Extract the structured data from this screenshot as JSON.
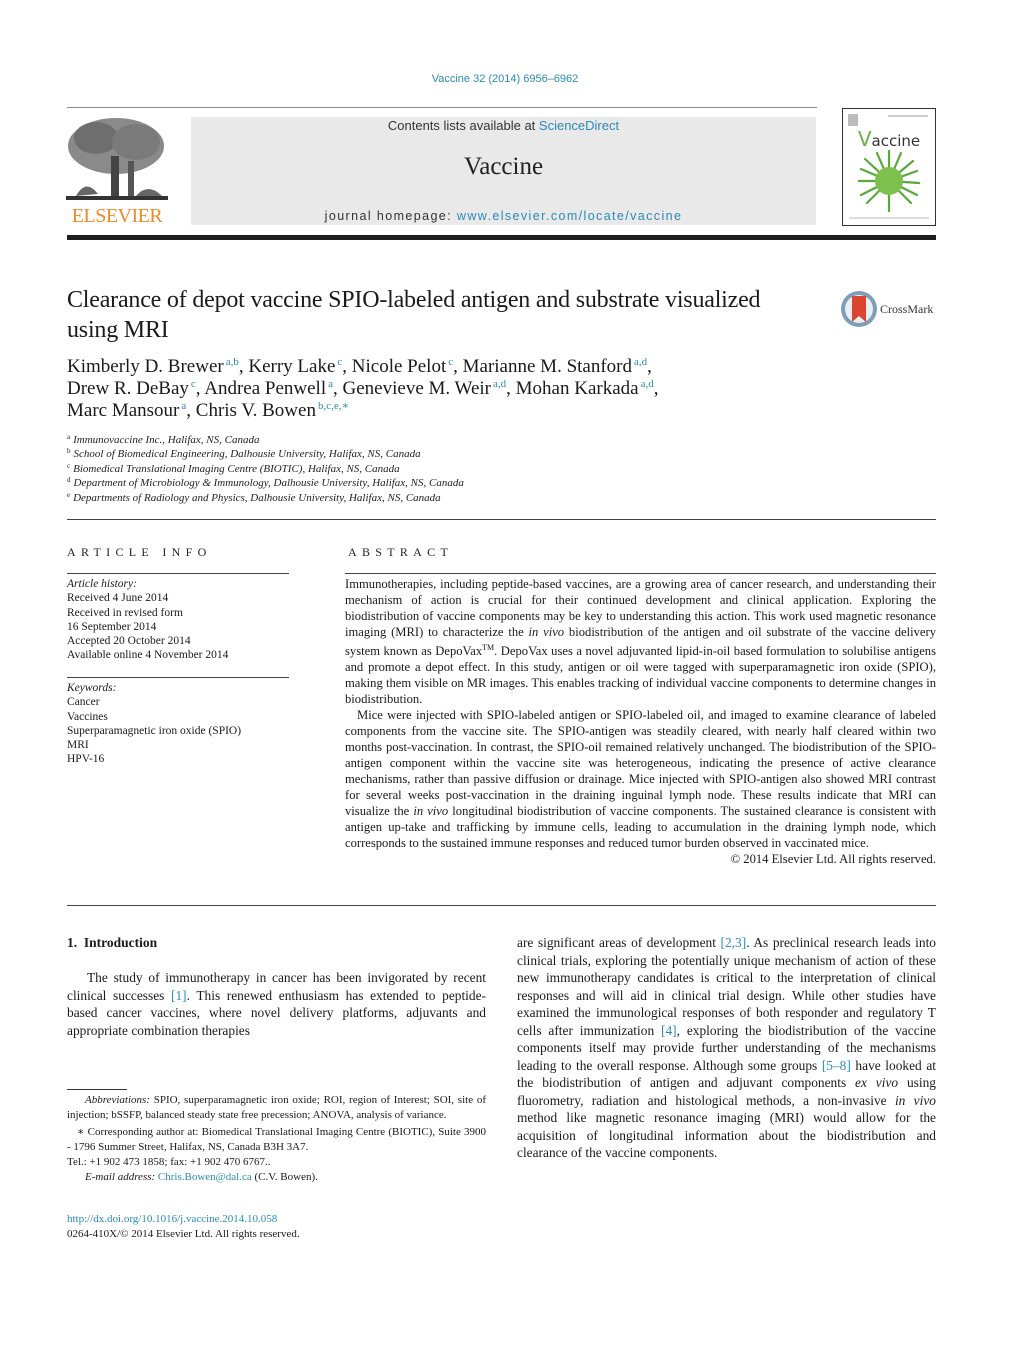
{
  "header": {
    "citation": "Vaccine 32 (2014) 6956–6962",
    "contents_prefix": "Contents lists available at ",
    "contents_link": "ScienceDirect",
    "journal_title": "Vaccine",
    "homepage_prefix": "journal homepage: ",
    "homepage_link": "www.elsevier.com/locate/vaccine",
    "publisher_logo": "ELSEVIER",
    "cover_title_v": "V",
    "cover_title_rest": "accine",
    "colors": {
      "link": "#2a8ab7",
      "elsevier_orange": "#f08a24",
      "banner_bg": "#e9e9e9",
      "cover_green": "#6ab04c"
    }
  },
  "article": {
    "title": "Clearance of depot vaccine SPIO-labeled antigen and substrate visualized using MRI",
    "crossmark_label": "CrossMark",
    "authors": [
      {
        "name": "Kimberly D. Brewer",
        "aff": "a,b"
      },
      {
        "name": "Kerry Lake",
        "aff": "c"
      },
      {
        "name": "Nicole Pelot",
        "aff": "c"
      },
      {
        "name": "Marianne M. Stanford",
        "aff": "a,d"
      },
      {
        "name": "Drew R. DeBay",
        "aff": "c"
      },
      {
        "name": "Andrea Penwell",
        "aff": "a"
      },
      {
        "name": "Genevieve M. Weir",
        "aff": "a,d"
      },
      {
        "name": "Mohan Karkada",
        "aff": "a,d"
      },
      {
        "name": "Marc Mansour",
        "aff": "a"
      },
      {
        "name": "Chris V. Bowen",
        "aff": "b,c,e,∗"
      }
    ],
    "affiliations": [
      {
        "key": "a",
        "text": "Immunovaccine Inc., Halifax, NS, Canada"
      },
      {
        "key": "b",
        "text": "School of Biomedical Engineering, Dalhousie University, Halifax, NS, Canada"
      },
      {
        "key": "c",
        "text": "Biomedical Translational Imaging Centre (BIOTIC), Halifax, NS, Canada"
      },
      {
        "key": "d",
        "text": "Department of Microbiology & Immunology, Dalhousie University, Halifax, NS, Canada"
      },
      {
        "key": "e",
        "text": "Departments of Radiology and Physics, Dalhousie University, Halifax, NS, Canada"
      }
    ]
  },
  "article_info": {
    "heading": "ARTICLE INFO",
    "history_label": "Article history:",
    "history": [
      "Received 4 June 2014",
      "Received in revised form",
      "16 September 2014",
      "Accepted 20 October 2014",
      "Available online 4 November 2014"
    ],
    "keywords_label": "Keywords:",
    "keywords": [
      "Cancer",
      "Vaccines",
      "Superparamagnetic iron oxide (SPIO)",
      "MRI",
      "HPV-16"
    ]
  },
  "abstract": {
    "heading": "ABSTRACT",
    "p1_a": "Immunotherapies, including peptide-based vaccines, are a growing area of cancer research, and understanding their mechanism of action is crucial for their continued development and clinical application. Exploring the biodistribution of vaccine components may be key to understanding this action. This work used magnetic resonance imaging (MRI) to characterize the ",
    "p1_em": "in vivo",
    "p1_b": " biodistribution of the antigen and oil substrate of the vaccine delivery system known as DepoVax",
    "p1_tm": "TM",
    "p1_c": ". DepoVax uses a novel adjuvanted lipid-in-oil based formulation to solubilise antigens and promote a depot effect. In this study, antigen or oil were tagged with superparamagnetic iron oxide (SPIO), making them visible on MR images. This enables tracking of individual vaccine components to determine changes in biodistribution.",
    "p2_a": "Mice were injected with SPIO-labeled antigen or SPIO-labeled oil, and imaged to examine clearance of labeled components from the vaccine site. The SPIO-antigen was steadily cleared, with nearly half cleared within two months post-vaccination. In contrast, the SPIO-oil remained relatively unchanged. The biodistribution of the SPIO-antigen component within the vaccine site was heterogeneous, indicating the presence of active clearance mechanisms, rather than passive diffusion or drainage. Mice injected with SPIO-antigen also showed MRI contrast for several weeks post-vaccination in the draining inguinal lymph node. These results indicate that MRI can visualize the ",
    "p2_em": "in vivo",
    "p2_b": " longitudinal biodistribution of vaccine components. The sustained clearance is consistent with antigen up-take and trafficking by immune cells, leading to accumulation in the draining lymph node, which corresponds to the sustained immune responses and reduced tumor burden observed in vaccinated mice.",
    "copyright": "© 2014 Elsevier Ltd. All rights reserved."
  },
  "introduction": {
    "heading": "1.  Introduction",
    "col1_a": "The study of immunotherapy in cancer has been invigorated by recent clinical successes ",
    "ref1": "[1]",
    "col1_b": ". This renewed enthusiasm has extended to peptide-based cancer vaccines, where novel delivery platforms, adjuvants and appropriate combination therapies",
    "col2_a": "are significant areas of development ",
    "ref2": "[2,3]",
    "col2_b": ". As preclinical research leads into clinical trials, exploring the potentially unique mechanism of action of these new immunotherapy candidates is critical to the interpretation of clinical responses and will aid in clinical trial design. While other studies have examined the immunological responses of both responder and regulatory T cells after immunization ",
    "ref3": "[4]",
    "col2_c": ", exploring the biodistribution of the vaccine components itself may provide further understanding of the mechanisms leading to the overall response. Although some groups ",
    "ref4": "[5–8]",
    "col2_d": " have looked at the biodistribution of antigen and adjuvant components ",
    "col2_em1": "ex vivo",
    "col2_e": " using fluorometry, radiation and histological methods, a non-invasive ",
    "col2_em2": "in vivo",
    "col2_f": " method like magnetic resonance imaging (MRI) would allow for the acquisition of longitudinal information about the biodistribution and clearance of the vaccine components."
  },
  "footnotes": {
    "abbrev_label": "Abbreviations:",
    "abbrev_text": " SPIO, superparamagnetic iron oxide; ROI, region of Interest; SOI, site of injection; bSSFP, balanced steady state free precession; ANOVA, analysis of variance.",
    "corr_mark": "∗",
    "corr_text": " Corresponding author at: Biomedical Translational Imaging Centre (BIOTIC), Suite 3900 - 1796 Summer Street, Halifax, NS, Canada B3H 3A7.",
    "tel_text": "Tel.: +1 902 473 1858; fax: +1 902 470 6767..",
    "email_label": "E-mail address:",
    "email": "Chris.Bowen@dal.ca",
    "email_suffix": " (C.V. Bowen).",
    "doi": "http://dx.doi.org/10.1016/j.vaccine.2014.10.058",
    "issn": "0264-410X/© 2014 Elsevier Ltd. All rights reserved."
  }
}
